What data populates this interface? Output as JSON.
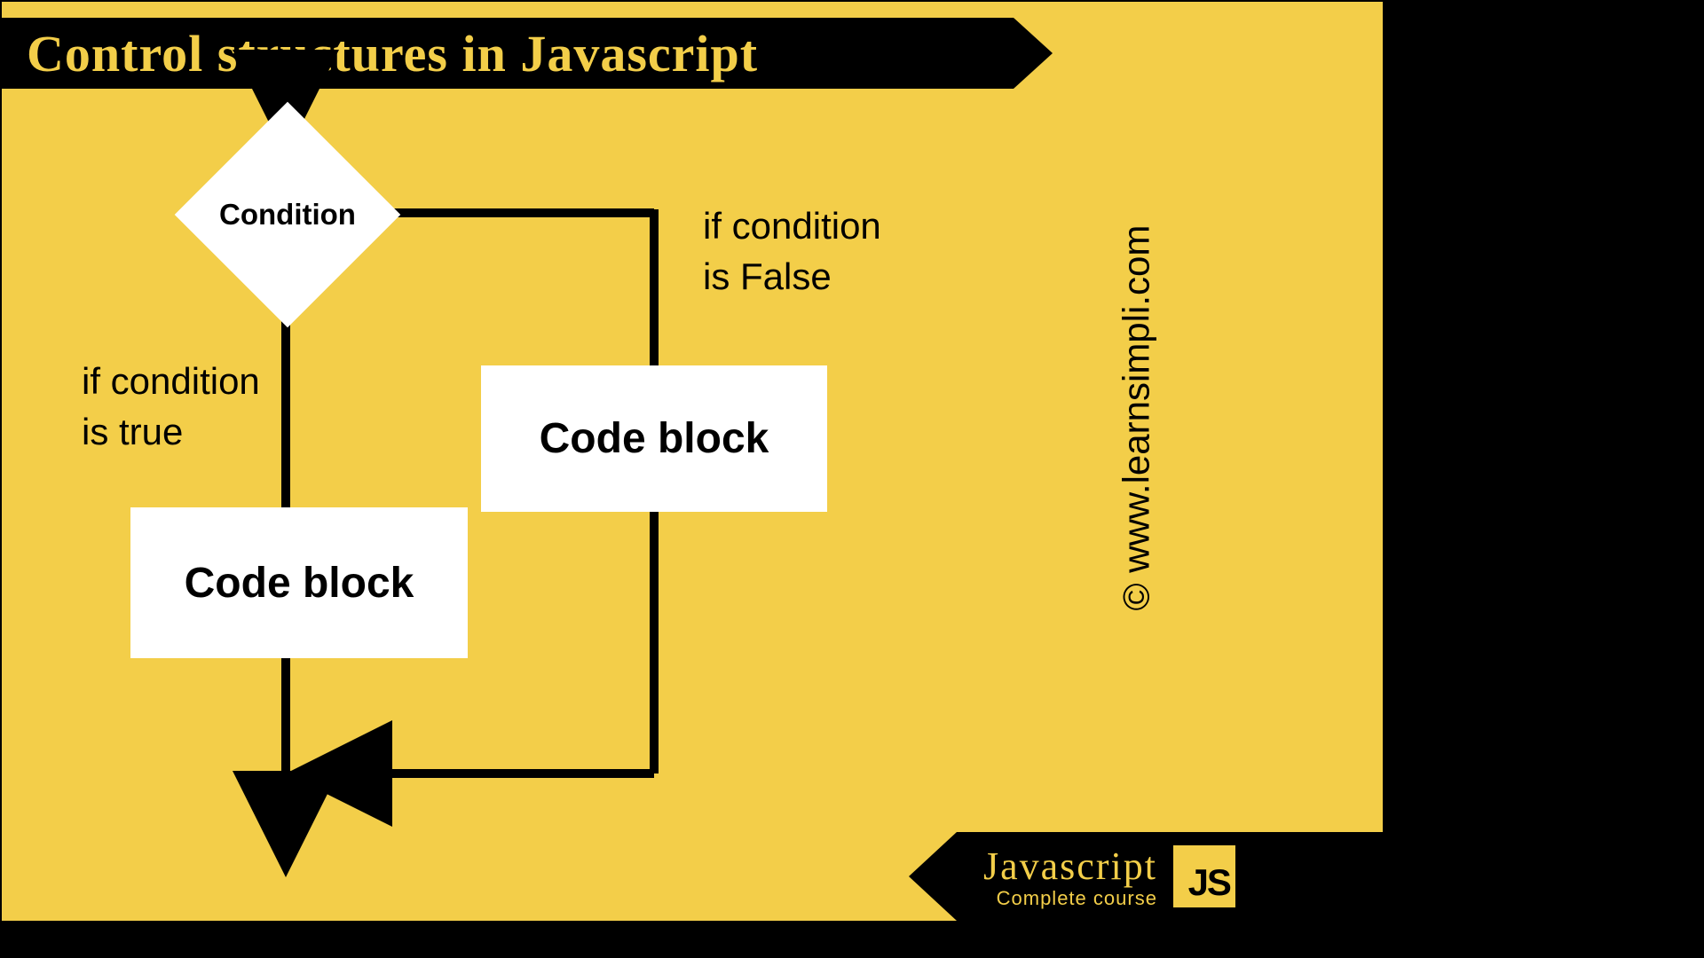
{
  "title": "Control structures in Javascript",
  "decision": "Condition",
  "true_label": "if condition\nis true",
  "false_label": "if condition\nis False",
  "true_block": "Code block",
  "false_block": "Code block",
  "copyright": "© www.learnsimpli.com",
  "footer": {
    "line1": "Javascript",
    "line2": "Complete course",
    "badge": "JS"
  },
  "chart_data": {
    "type": "flowchart",
    "title": "Control structures in Javascript",
    "nodes": [
      {
        "id": "start",
        "type": "start",
        "label": ""
      },
      {
        "id": "cond",
        "type": "decision",
        "label": "Condition"
      },
      {
        "id": "block_true",
        "type": "process",
        "label": "Code block"
      },
      {
        "id": "block_false",
        "type": "process",
        "label": "Code block"
      },
      {
        "id": "merge",
        "type": "merge",
        "label": ""
      },
      {
        "id": "end",
        "type": "end",
        "label": ""
      }
    ],
    "edges": [
      {
        "from": "start",
        "to": "cond",
        "label": ""
      },
      {
        "from": "cond",
        "to": "block_true",
        "label": "if condition is true"
      },
      {
        "from": "cond",
        "to": "block_false",
        "label": "if condition is False"
      },
      {
        "from": "block_true",
        "to": "merge",
        "label": ""
      },
      {
        "from": "block_false",
        "to": "merge",
        "label": ""
      },
      {
        "from": "merge",
        "to": "end",
        "label": ""
      }
    ]
  }
}
